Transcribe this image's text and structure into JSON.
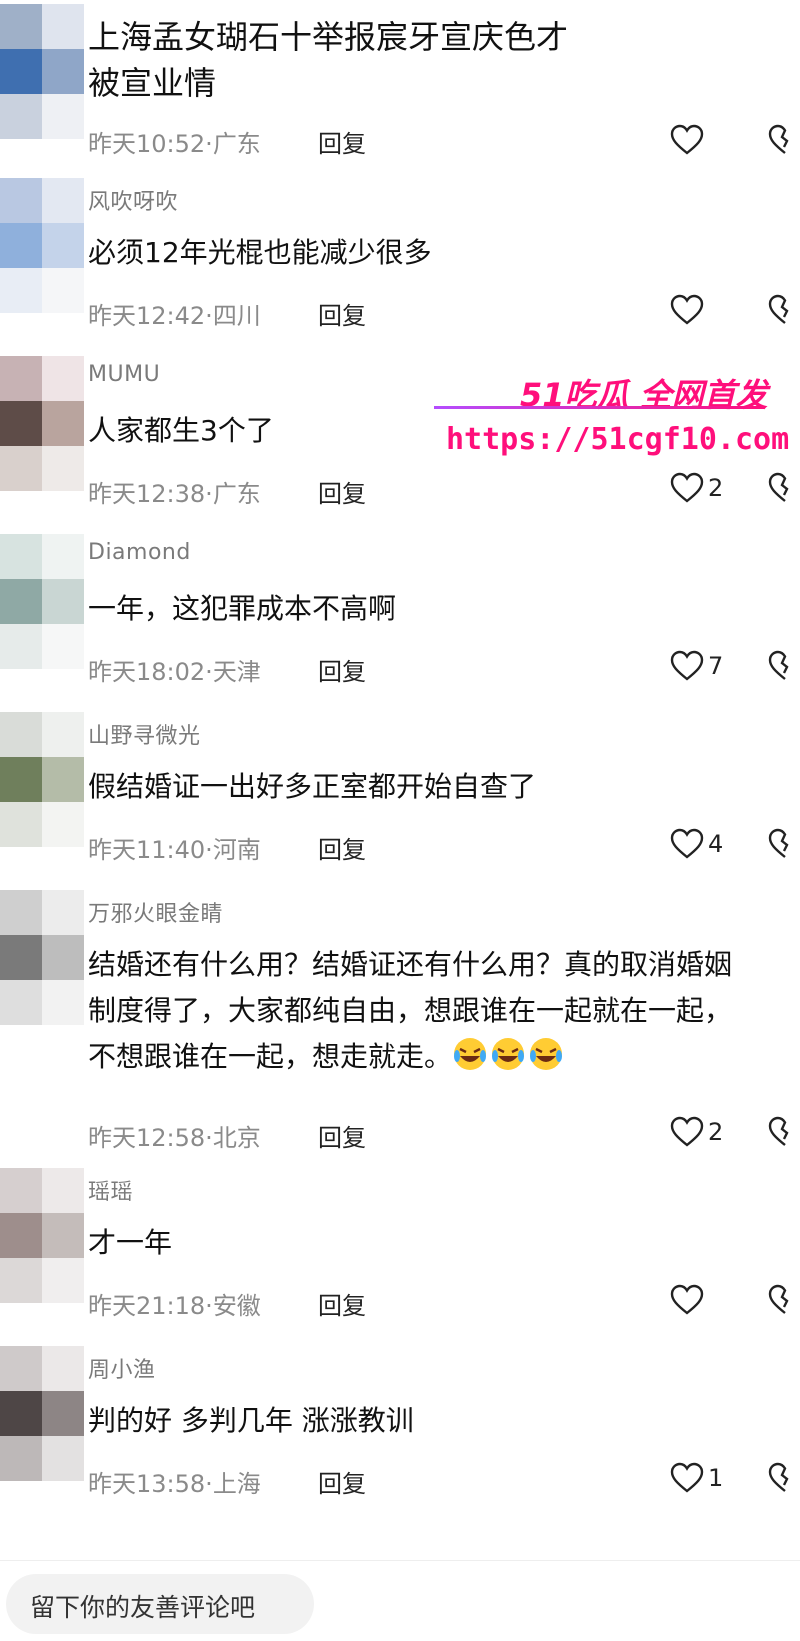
{
  "comments": [
    {
      "name": "",
      "text": "上海孟女瑚石十举报宸牙宣庆色才\n被宣业情",
      "time": "昨天10:52",
      "region": "广东",
      "reply": "回复",
      "likes": ""
    },
    {
      "name": "风吹呀吹",
      "text": "必须12年光棍也能减少很多",
      "time": "昨天12:42",
      "region": "四川",
      "reply": "回复",
      "likes": ""
    },
    {
      "name": "MUMU",
      "text": "人家都生3个了",
      "time": "昨天12:38",
      "region": "广东",
      "reply": "回复",
      "likes": "2"
    },
    {
      "name": "Diamond",
      "text": "一年，这犯罪成本不高啊",
      "time": "昨天18:02",
      "region": "天津",
      "reply": "回复",
      "likes": "7"
    },
    {
      "name": "山野寻微光",
      "text": "假结婚证一出好多正室都开始自查了",
      "time": "昨天11:40",
      "region": "河南",
      "reply": "回复",
      "likes": "4"
    },
    {
      "name": "万邪火眼金睛",
      "text": "结婚还有什么用？结婚证还有什么用？真的取消婚姻\n制度得了，大家都纯自由，想跟谁在一起就在一起，\n不想跟谁在一起，想走就走。",
      "time": "昨天12:58",
      "region": "北京",
      "reply": "回复",
      "likes": "2"
    },
    {
      "name": "瑶瑶",
      "text": "才一年",
      "time": "昨天21:18",
      "region": "安徽",
      "reply": "回复",
      "likes": ""
    },
    {
      "name": "周小渔",
      "text": "判的好 多判几年 涨涨教训",
      "time": "昨天13:58",
      "region": "上海",
      "reply": "回复",
      "likes": "1"
    }
  ],
  "watermark": {
    "brand": "51吃瓜 全网首发",
    "url": "https://51cgf10.com"
  },
  "input": {
    "placeholder": "留下你的友善评论吧"
  },
  "icons": {
    "like": "heart-outline-icon",
    "dislike": "broken-heart-icon",
    "emoji": "laughing-crying-emoji"
  },
  "colors": {
    "watermark": "#ff0f7b",
    "meta": "#8a8a8a",
    "name": "#7a7a7a"
  }
}
